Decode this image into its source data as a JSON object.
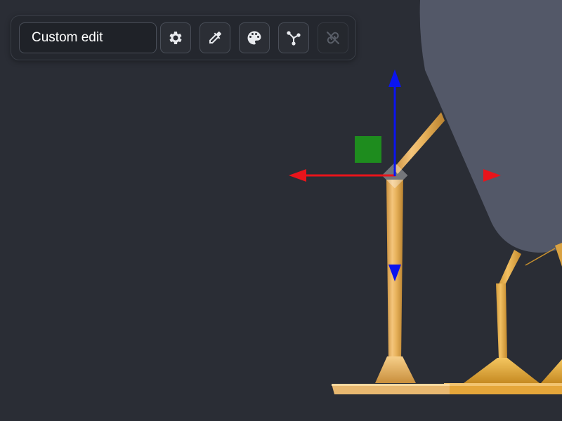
{
  "toolbar": {
    "mode_label": "Custom edit",
    "buttons": [
      {
        "icon": "gear-icon",
        "enabled": true
      },
      {
        "icon": "eyedropper-icon",
        "enabled": true
      },
      {
        "icon": "palette-icon",
        "enabled": true
      },
      {
        "icon": "vertex-graph-icon",
        "enabled": true
      },
      {
        "icon": "unlink-icon",
        "enabled": false
      }
    ]
  },
  "colors": {
    "background": "#2a2d35",
    "icon": "#e8eaee",
    "icon_disabled": "#5a5f69",
    "gizmo_x": "#e8141b",
    "gizmo_z": "#0a14f0",
    "gizmo_plane": "#1e8c1e",
    "leg_gold": "#e8b254",
    "body_grey": "#535868"
  }
}
